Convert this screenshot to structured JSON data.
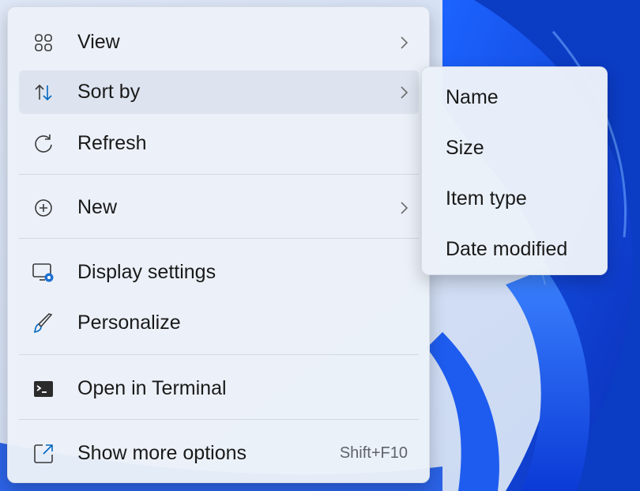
{
  "menu": {
    "items": [
      {
        "label": "View",
        "icon": "view-grid-icon",
        "submenu": true
      },
      {
        "label": "Sort by",
        "icon": "sort-arrows-icon",
        "submenu": true
      },
      {
        "label": "Refresh",
        "icon": "refresh-icon",
        "submenu": false
      },
      {
        "label": "New",
        "icon": "plus-circle-icon",
        "submenu": true
      },
      {
        "label": "Display settings",
        "icon": "display-settings-icon",
        "submenu": false
      },
      {
        "label": "Personalize",
        "icon": "brush-icon",
        "submenu": false
      },
      {
        "label": "Open in Terminal",
        "icon": "terminal-icon",
        "submenu": false
      },
      {
        "label": "Show more options",
        "icon": "more-options-icon",
        "submenu": false,
        "shortcut": "Shift+F10"
      }
    ]
  },
  "submenu": {
    "items": [
      {
        "label": "Name"
      },
      {
        "label": "Size"
      },
      {
        "label": "Item type"
      },
      {
        "label": "Date modified"
      }
    ]
  },
  "colors": {
    "accent": "#0067c0",
    "wallpaper": "#1d4fd8"
  }
}
